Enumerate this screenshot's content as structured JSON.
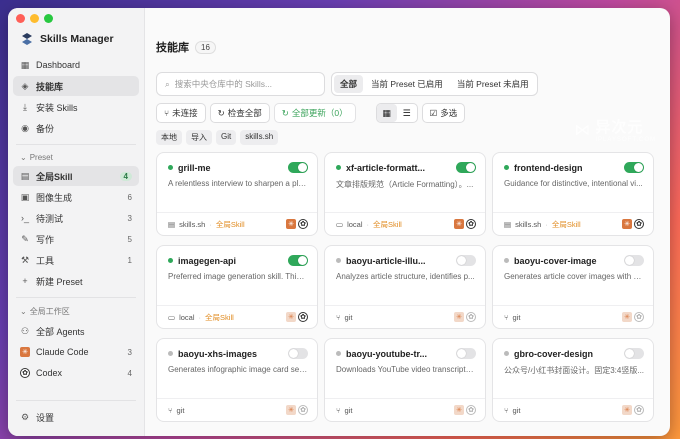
{
  "app": {
    "name": "Skills Manager"
  },
  "nav": {
    "dashboard": "Dashboard",
    "library": "技能库",
    "install": "安装 Skills",
    "backup": "备份"
  },
  "preset": {
    "title": "Preset",
    "items": [
      {
        "label": "全局Skill",
        "count": "4"
      },
      {
        "label": "图像生成",
        "count": "6"
      },
      {
        "label": "待测试",
        "count": "3"
      },
      {
        "label": "写作",
        "count": "5"
      },
      {
        "label": "工具",
        "count": "1"
      }
    ],
    "new_label": "新建 Preset"
  },
  "workspace": {
    "title": "全局工作区",
    "items": [
      {
        "label": "全部 Agents",
        "count": ""
      },
      {
        "label": "Claude Code",
        "count": "3"
      },
      {
        "label": "Codex",
        "count": "4"
      }
    ]
  },
  "settings_label": "设置",
  "header": {
    "title": "技能库",
    "count": "16"
  },
  "search": {
    "placeholder": "搜索中央仓库中的 Skills..."
  },
  "segments": [
    "全部",
    "当前 Preset 已启用",
    "当前 Preset 未启用"
  ],
  "toolbar": {
    "disconnected": "未连接",
    "check_all": "检查全部",
    "update_all": "全部更新（0）",
    "multi_select": "多选"
  },
  "filters": [
    "本地",
    "导入",
    "Git",
    "skills.sh"
  ],
  "cards": [
    {
      "name": "grill-me",
      "desc": "A relentless interview to sharpen a pla...",
      "enabled": true,
      "source": "skills.sh",
      "scope": "全局Skill",
      "claude": true,
      "codex": true
    },
    {
      "name": "xf-article-formatt...",
      "desc": "文章排版规范（Article Formatting）。...",
      "enabled": true,
      "source": "local",
      "scope": "全局Skill",
      "claude": true,
      "codex": true
    },
    {
      "name": "frontend-design",
      "desc": "Guidance for distinctive, intentional vi...",
      "enabled": true,
      "source": "skills.sh",
      "scope": "全局Skill",
      "claude": true,
      "codex": true
    },
    {
      "name": "imagegen-api",
      "desc": "Preferred image generation skill. This ...",
      "enabled": true,
      "source": "local",
      "scope": "全局Skill",
      "claude": false,
      "codex": true
    },
    {
      "name": "baoyu-article-illu...",
      "desc": "Analyzes article structure, identifies p...",
      "enabled": false,
      "source": "git",
      "scope": "",
      "claude": false,
      "codex": false
    },
    {
      "name": "baoyu-cover-image",
      "desc": "Generates article cover images with 5...",
      "enabled": false,
      "source": "git",
      "scope": "",
      "claude": false,
      "codex": false
    },
    {
      "name": "baoyu-xhs-images",
      "desc": "Generates infographic image card ser...",
      "enabled": false,
      "source": "git",
      "scope": "",
      "claude": false,
      "codex": false
    },
    {
      "name": "baoyu-youtube-tr...",
      "desc": "Downloads YouTube video transcripts...",
      "enabled": false,
      "source": "git",
      "scope": "",
      "claude": false,
      "codex": false
    },
    {
      "name": "gbro-cover-design",
      "desc": "公众号/小红书封面设计。固定3:4竖版...",
      "enabled": false,
      "source": "git",
      "scope": "",
      "claude": false,
      "codex": false
    }
  ],
  "watermark": {
    "big": "异次元",
    "small": "IPLAYSOFT.COM"
  },
  "colors": {
    "accent_green": "#2fa85a",
    "scope_orange": "#e08a1e"
  }
}
